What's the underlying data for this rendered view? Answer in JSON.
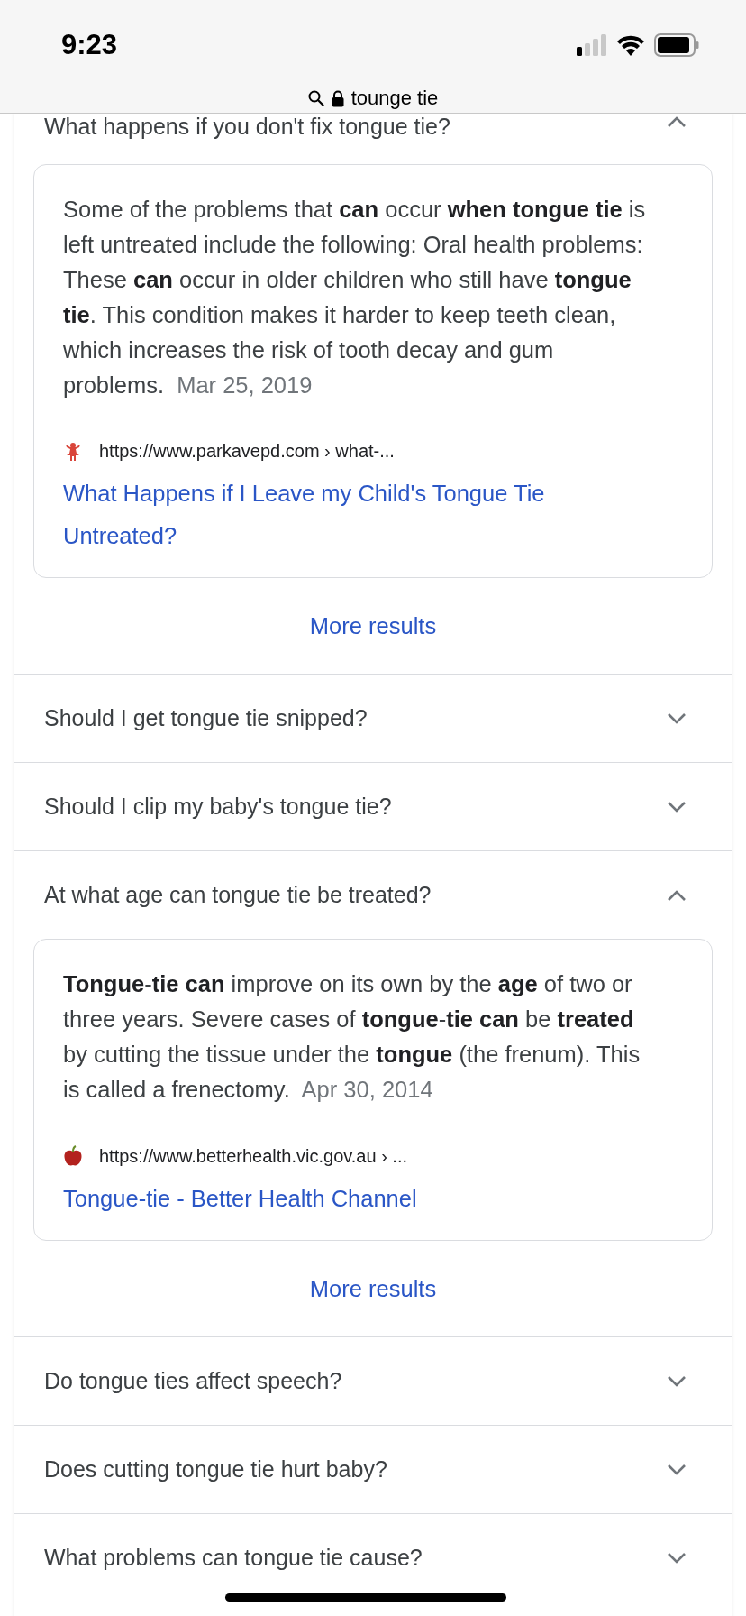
{
  "status_bar": {
    "time": "9:23"
  },
  "address_bar": {
    "query": "tounge tie"
  },
  "questions": [
    {
      "question": "What happens if you don't fix tongue tie?",
      "expanded": true,
      "answer": {
        "text": "Some of the problems that **can** occur **when tongue tie** is left untreated include the following: Oral health problems: These **can** occur in older children who still have **tongue tie**. This condition makes it harder to keep teeth clean, which increases the risk of tooth decay and gum problems.",
        "date": "Mar 25, 2019",
        "kind": "figure",
        "url": "https://www.parkavepd.com › what-...",
        "title": "What Happens if I Leave my Child's Tongue Tie Untreated?"
      },
      "more": "More results"
    },
    {
      "question": "Should I get tongue tie snipped?",
      "expanded": false
    },
    {
      "question": "Should I clip my baby's tongue tie?",
      "expanded": false
    },
    {
      "question": "At what age can tongue tie be treated?",
      "expanded": true,
      "answer": {
        "text": "**Tongue**-**tie can** improve on its own by the **age** of two or three years. Severe cases of **tongue**-**tie can** be **treated** by cutting the tissue under the **tongue** (the frenum). This is called a frenectomy.",
        "date": "Apr 30, 2014",
        "kind": "apple",
        "url": "https://www.betterhealth.vic.gov.au › ...",
        "title": "Tongue-tie - Better Health Channel"
      },
      "more": "More results"
    },
    {
      "question": "Do tongue ties affect speech?",
      "expanded": false
    },
    {
      "question": "Does cutting tongue tie hurt baby?",
      "expanded": false
    },
    {
      "question": "What problems can tongue tie cause?",
      "expanded": false
    }
  ]
}
